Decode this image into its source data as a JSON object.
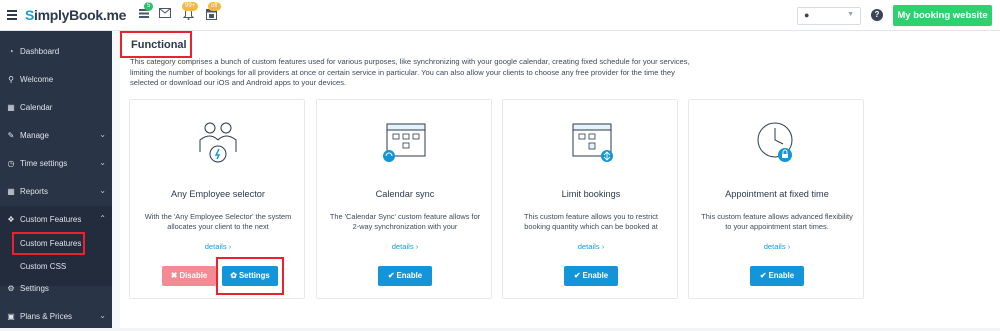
{
  "topbar": {
    "logo_s": "S",
    "logo_main": "implyBook",
    "logo_me": ".me",
    "badge_tasks": "5",
    "badge_bell": "99+",
    "badge_calendar": "off",
    "booking_button": "My booking website",
    "help": "?"
  },
  "sidebar": {
    "items": [
      {
        "label": "Dashboard",
        "icon": "dashboard-icon"
      },
      {
        "label": "Welcome",
        "icon": "lightbulb-icon"
      },
      {
        "label": "Calendar",
        "icon": "calendar-icon"
      },
      {
        "label": "Manage",
        "icon": "pencil-icon"
      },
      {
        "label": "Time settings",
        "icon": "clock-icon"
      },
      {
        "label": "Reports",
        "icon": "bar-chart-icon"
      },
      {
        "label": "Custom Features",
        "icon": "puzzle-icon"
      },
      {
        "label": "Settings",
        "icon": "gears-icon"
      },
      {
        "label": "Plans & Prices",
        "icon": "money-icon"
      }
    ],
    "sub_items": [
      "Custom Features",
      "Custom CSS"
    ]
  },
  "main": {
    "title": "Functional",
    "description": "This category comprises a bunch of custom features used for various purposes, like synchronizing with your google calendar, creating fixed schedule for your services, limiting the number of bookings for all providers at once or certain service in particular. You can also allow your clients to choose any free provider for the time they selected or download our iOS and Android apps to your devices.",
    "cards": [
      {
        "title": "Any Employee selector",
        "desc": "With the 'Any Employee Selector' the system allocates your client to the next",
        "details": "details ›",
        "disable": "✖ Disable",
        "settings": "✿ Settings"
      },
      {
        "title": "Calendar sync",
        "desc": "The 'Calendar Sync' custom feature allows for 2-way synchronization with your",
        "details": "details ›",
        "enable": "✔ Enable"
      },
      {
        "title": "Limit bookings",
        "desc": "This custom feature allows you to restrict booking quantity which can be booked at",
        "details": "details ›",
        "enable": "✔ Enable"
      },
      {
        "title": "Appointment at fixed time",
        "desc": "This custom feature allows advanced flexibility to your appointment start times.",
        "details": "details ›",
        "enable": "✔ Enable"
      }
    ]
  },
  "colors": {
    "accent": "#1495d9",
    "green": "#2fd06f",
    "sidebar": "#2a3447",
    "highlight": "#e8232f"
  }
}
